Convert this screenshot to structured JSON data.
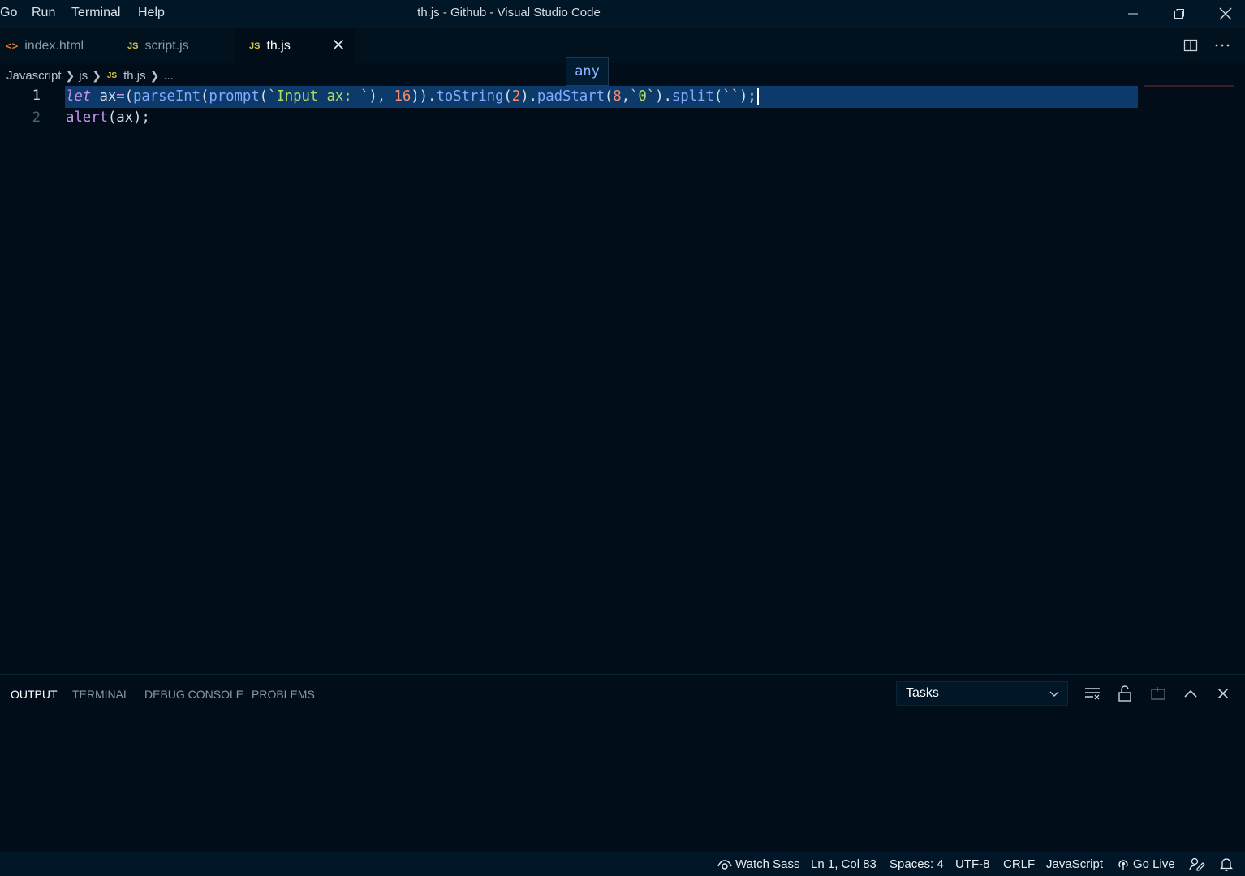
{
  "menu": {
    "go": "Go",
    "run": "Run",
    "terminal": "Terminal",
    "help": "Help"
  },
  "window": {
    "title": "th.js - Github - Visual Studio Code"
  },
  "tabs": [
    {
      "label": "index.html",
      "icon": "<>",
      "active": false
    },
    {
      "label": "script.js",
      "icon": "JS",
      "active": false
    },
    {
      "label": "th.js",
      "icon": "JS",
      "active": true
    }
  ],
  "breadcrumb": {
    "root": "Javascript",
    "folder": "js",
    "file_icon": "JS",
    "file": "th.js",
    "more": "..."
  },
  "hover": {
    "text": "any"
  },
  "editor": {
    "line_numbers": [
      "1",
      "2"
    ],
    "line1": {
      "kw": "let",
      "var": "ax",
      "eq": "=",
      "p1": "(",
      "fn1": "parseInt",
      "p2": "(",
      "fn2": "prompt",
      "p3": "(",
      "s1a": "`",
      "s1b": "Input ax: ",
      "s1c": "`",
      "p4": "),",
      "sp": " ",
      "n1": "16",
      "p5": ")).",
      "m1": "toString",
      "p6": "(",
      "n2": "2",
      "p7": ").",
      "m2": "padStart",
      "p8": "(",
      "n3": "8",
      "p9": ",",
      "s2a": "`",
      "s2b": "0",
      "s2c": "`",
      "p10": ").",
      "m3": "split",
      "p11": "(",
      "s3": "``",
      "p12": ");"
    },
    "line2": {
      "fn": "alert",
      "p1": "(",
      "var": "ax",
      "p2": ");"
    }
  },
  "panel": {
    "tabs": [
      "OUTPUT",
      "TERMINAL",
      "DEBUG CONSOLE",
      "PROBLEMS"
    ],
    "active_tab": "OUTPUT",
    "select_value": "Tasks"
  },
  "statusbar": {
    "watch_sass": "Watch Sass",
    "position": "Ln 1, Col 83",
    "spaces": "Spaces: 4",
    "encoding": "UTF-8",
    "eol": "CRLF",
    "language": "JavaScript",
    "go_live": "Go Live"
  },
  "colors": {
    "background": "#010e1a",
    "selection": "#0c3a6a",
    "statusbar": "#011627"
  }
}
